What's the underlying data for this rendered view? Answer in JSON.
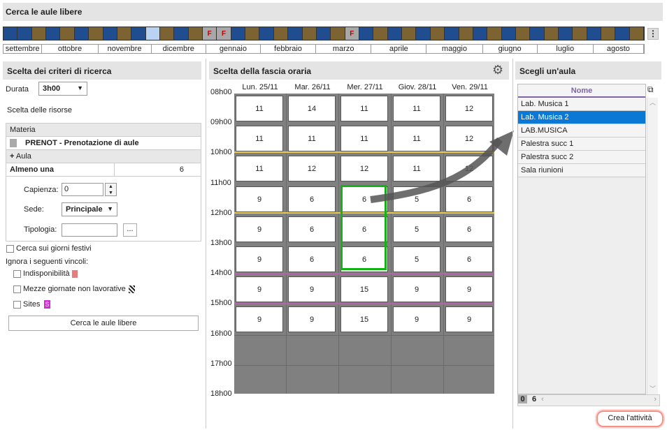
{
  "app": {
    "title": "Cerca le aule libere"
  },
  "weekstrip": {
    "weeks": [
      "b",
      "b",
      "o",
      "b",
      "o",
      "b",
      "o",
      "b",
      "o",
      "b",
      "s",
      "o",
      "b",
      "o",
      "f",
      "f",
      "b",
      "o",
      "b",
      "o",
      "b",
      "o",
      "b",
      "o",
      "f",
      "b",
      "o",
      "b",
      "o",
      "b",
      "o",
      "b",
      "o",
      "b",
      "o",
      "b",
      "o",
      "b",
      "o",
      "b",
      "o",
      "b",
      "o",
      "b",
      "o"
    ],
    "holiday_label": "F",
    "menu_icon": "⋮"
  },
  "months": [
    "settembre",
    "ottobre",
    "novembre",
    "dicembre",
    "gennaio",
    "febbraio",
    "marzo",
    "aprile",
    "maggio",
    "giugno",
    "luglio",
    "agosto"
  ],
  "criteria": {
    "title": "Scelta dei criteri di ricerca",
    "duration_label": "Durata",
    "duration_value": "3h00",
    "resources_label": "Scelta delle risorse",
    "subject_header": "Materia",
    "subject_value": "PRENOT - Prenotazione di aule",
    "room_header": "Aula",
    "room_qty_label": "Almeno una",
    "room_qty_value": "6",
    "capacity_label": "Capienza:",
    "capacity_value": "0",
    "site_label": "Sede:",
    "site_value": "Principale",
    "type_label": "Tipologia:",
    "type_btn": "...",
    "holidays_label": "Cerca sui giorni festivi",
    "ignore_label": "Ignora i seguenti vincoli:",
    "unavail_label": "Indisponibilità",
    "half_days_label": "Mezze giornate non lavorative",
    "sites_label": "Sites",
    "sites_tag": "S",
    "search_button": "Cerca le aule libere"
  },
  "timeslot": {
    "title": "Scelta della fascia oraria",
    "days": [
      "Lun. 25/11",
      "Mar. 26/11",
      "Mer. 27/11",
      "Giov. 28/11",
      "Ven. 29/11"
    ],
    "hours": [
      "08h00",
      "09h00",
      "10h00",
      "11h00",
      "12h00",
      "13h00",
      "14h00",
      "15h00",
      "16h00",
      "17h00",
      "18h00"
    ],
    "rows": [
      [
        "11",
        "14",
        "11",
        "11",
        "12"
      ],
      [
        "11",
        "11",
        "11",
        "11",
        "12"
      ],
      [
        "11",
        "12",
        "12",
        "11",
        "12"
      ],
      [
        "9",
        "6",
        "6",
        "5",
        "6"
      ],
      [
        "9",
        "6",
        "6",
        "5",
        "6"
      ],
      [
        "9",
        "6",
        "6",
        "5",
        "6"
      ],
      [
        "9",
        "9",
        "15",
        "9",
        "9"
      ],
      [
        "9",
        "9",
        "15",
        "9",
        "9"
      ]
    ]
  },
  "rooms": {
    "title": "Scegli un'aula",
    "column_header": "Nome",
    "items": [
      "Lab. Musica 1",
      "Lab. Musica 2",
      "LAB.MUSICA",
      "Palestra succ 1",
      "Palestra succ 2",
      "Sala riunioni"
    ],
    "selected_index": 1,
    "footer_count_a": "0",
    "footer_count_b": "6"
  },
  "actions": {
    "create_button": "Crea l'attività"
  },
  "colors": {
    "blue_week": "#1f4d8f",
    "brown_week": "#7d6232",
    "selection": "#0a78d4",
    "green_highlight": "#12b312"
  }
}
